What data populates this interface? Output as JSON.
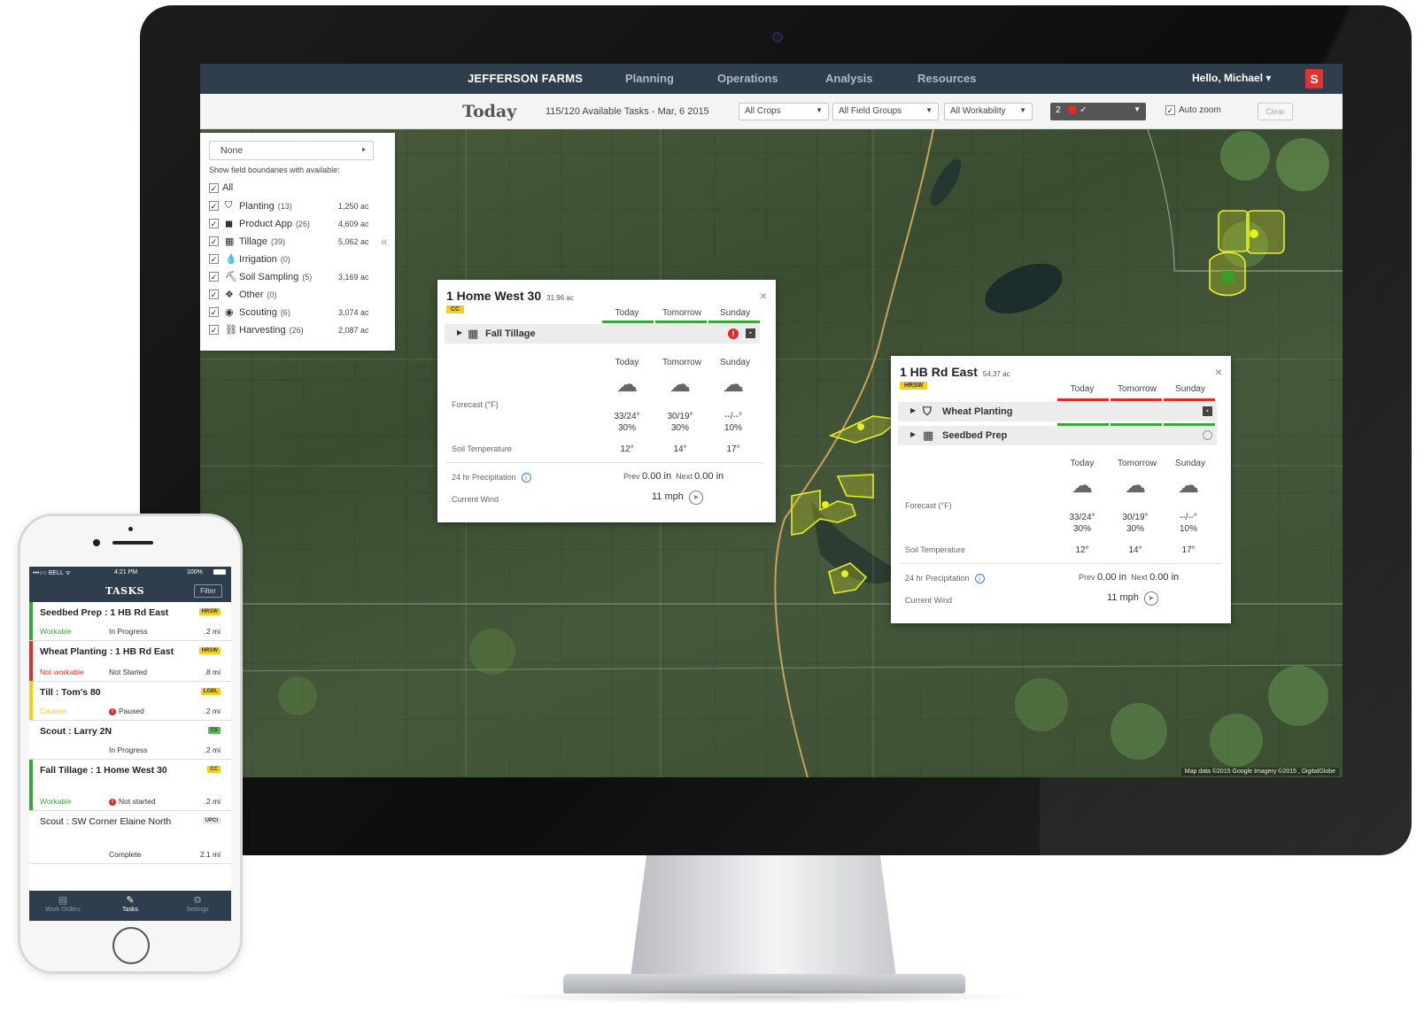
{
  "app": {
    "brand": "JEFFERSON FARMS",
    "nav": [
      "Planning",
      "Operations",
      "Analysis",
      "Resources"
    ],
    "user_greeting": "Hello, Michael",
    "logo_glyph": "S"
  },
  "toolbar": {
    "title": "Today",
    "task_count": "115/120 Available Tasks - Mar, 6 2015",
    "crops": "All Crops",
    "field_groups": "All Field Groups",
    "workability": "All Workability",
    "status_count": "2",
    "status_check": "✓",
    "auto_zoom": "Auto zoom",
    "clear": "Clear"
  },
  "filter_panel": {
    "select_value": "None",
    "hint": "Show field boundaries with available:",
    "all_label": "All",
    "items": [
      {
        "label": "Planting",
        "count": "(13)",
        "acres": "1,250 ac",
        "icon": "planting-icon",
        "glyph": "⛉"
      },
      {
        "label": "Product App",
        "count": "(26)",
        "acres": "4,609 ac",
        "icon": "product-app-icon",
        "glyph": "◼"
      },
      {
        "label": "Tillage",
        "count": "(39)",
        "acres": "5,062 ac",
        "icon": "tillage-icon",
        "glyph": "▦"
      },
      {
        "label": "Irrigation",
        "count": "(0)",
        "acres": "",
        "icon": "irrigation-icon",
        "glyph": "💧"
      },
      {
        "label": "Soil Sampling",
        "count": "(5)",
        "acres": "3,169 ac",
        "icon": "soil-sampling-icon",
        "glyph": "⛏"
      },
      {
        "label": "Other",
        "count": "(0)",
        "acres": "",
        "icon": "other-icon",
        "glyph": "❖"
      },
      {
        "label": "Scouting",
        "count": "(6)",
        "acres": "3,074 ac",
        "icon": "scouting-icon",
        "glyph": "◉"
      },
      {
        "label": "Harvesting",
        "count": "(26)",
        "acres": "2,087 ac",
        "icon": "harvesting-icon",
        "glyph": "⛓"
      }
    ]
  },
  "popup1": {
    "title": "1 Home West 30",
    "acres": "31.96 ac",
    "crop": "CC",
    "days": [
      "Today",
      "Tomorrow",
      "Sunday"
    ],
    "task": "Fall Tillage",
    "forecast_label": "Forecast (°F)",
    "temps": [
      "33/24°",
      "30/19°",
      "--/--°"
    ],
    "precip_pct": [
      "30%",
      "30%",
      "10%"
    ],
    "soil_label": "Soil Temperature",
    "soil": [
      "12°",
      "14°",
      "17°"
    ],
    "precip_label": "24 hr Precipitation",
    "prev_label": "Prev",
    "prev_value": "0.00 in",
    "next_label": "Next",
    "next_value": "0.00 in",
    "wind_label": "Current Wind",
    "wind_value": "11 mph"
  },
  "popup2": {
    "title": "1 HB Rd East",
    "acres": "54.37 ac",
    "crop": "HRSW",
    "days": [
      "Today",
      "Tomorrow",
      "Sunday"
    ],
    "tasks": [
      "Wheat Planting",
      "Seedbed Prep"
    ],
    "forecast_label": "Forecast (°F)",
    "temps": [
      "33/24°",
      "30/19°",
      "--/--°"
    ],
    "precip_pct": [
      "30%",
      "30%",
      "10%"
    ],
    "soil_label": "Soil Temperature",
    "soil": [
      "12°",
      "14°",
      "17°"
    ],
    "precip_label": "24 hr Precipitation",
    "prev_label": "Prev",
    "prev_value": "0.00 in",
    "next_label": "Next",
    "next_value": "0.00 in",
    "wind_label": "Current Wind",
    "wind_value": "11 mph"
  },
  "map": {
    "attribution": "Map data ©2015 Google Imagery ©2015 , DigitalGlobe"
  },
  "phone": {
    "carrier": "•••○○ BELL ᯤ",
    "time": "4:21 PM",
    "battery": "100%",
    "header": "TASKS",
    "filter": "Filter",
    "tasks": [
      {
        "name": "Seedbed Prep : 1 HB Rd East",
        "tag": "HRSW",
        "workability": "Workable",
        "status": "In Progress",
        "distance": ".2 mi"
      },
      {
        "name": "Wheat Planting : 1 HB Rd East",
        "tag": "HRSW",
        "workability": "Not workable",
        "status": "Not Started",
        "distance": ".8 mi"
      },
      {
        "name": "Till : Tom's 80",
        "tag": "LGBL",
        "workability": "Caution",
        "status": "Paused",
        "distance": ".2 mi"
      },
      {
        "name": "Scout : Larry 2N",
        "tag": "CS",
        "workability": "",
        "status": "In Progress",
        "distance": ".2 mi"
      },
      {
        "name": "Fall Tillage : 1 Home West 30",
        "tag": "CC",
        "workability": "Workable",
        "status": "Not started",
        "distance": ".2 mi"
      },
      {
        "name": "Scout : SW Corner Elaine North",
        "tag": "UPCI",
        "workability": "",
        "status": "Complete",
        "distance": "2.1 mi"
      }
    ],
    "tabs": [
      "Work Orders",
      "Tasks",
      "Settings"
    ]
  },
  "colors": {
    "nav_bg": "#2e3e4c",
    "workable": "#3aa63a",
    "not_workable": "#e02b2b",
    "caution": "#f3cf1c",
    "field_highlight": "#e6f020"
  }
}
